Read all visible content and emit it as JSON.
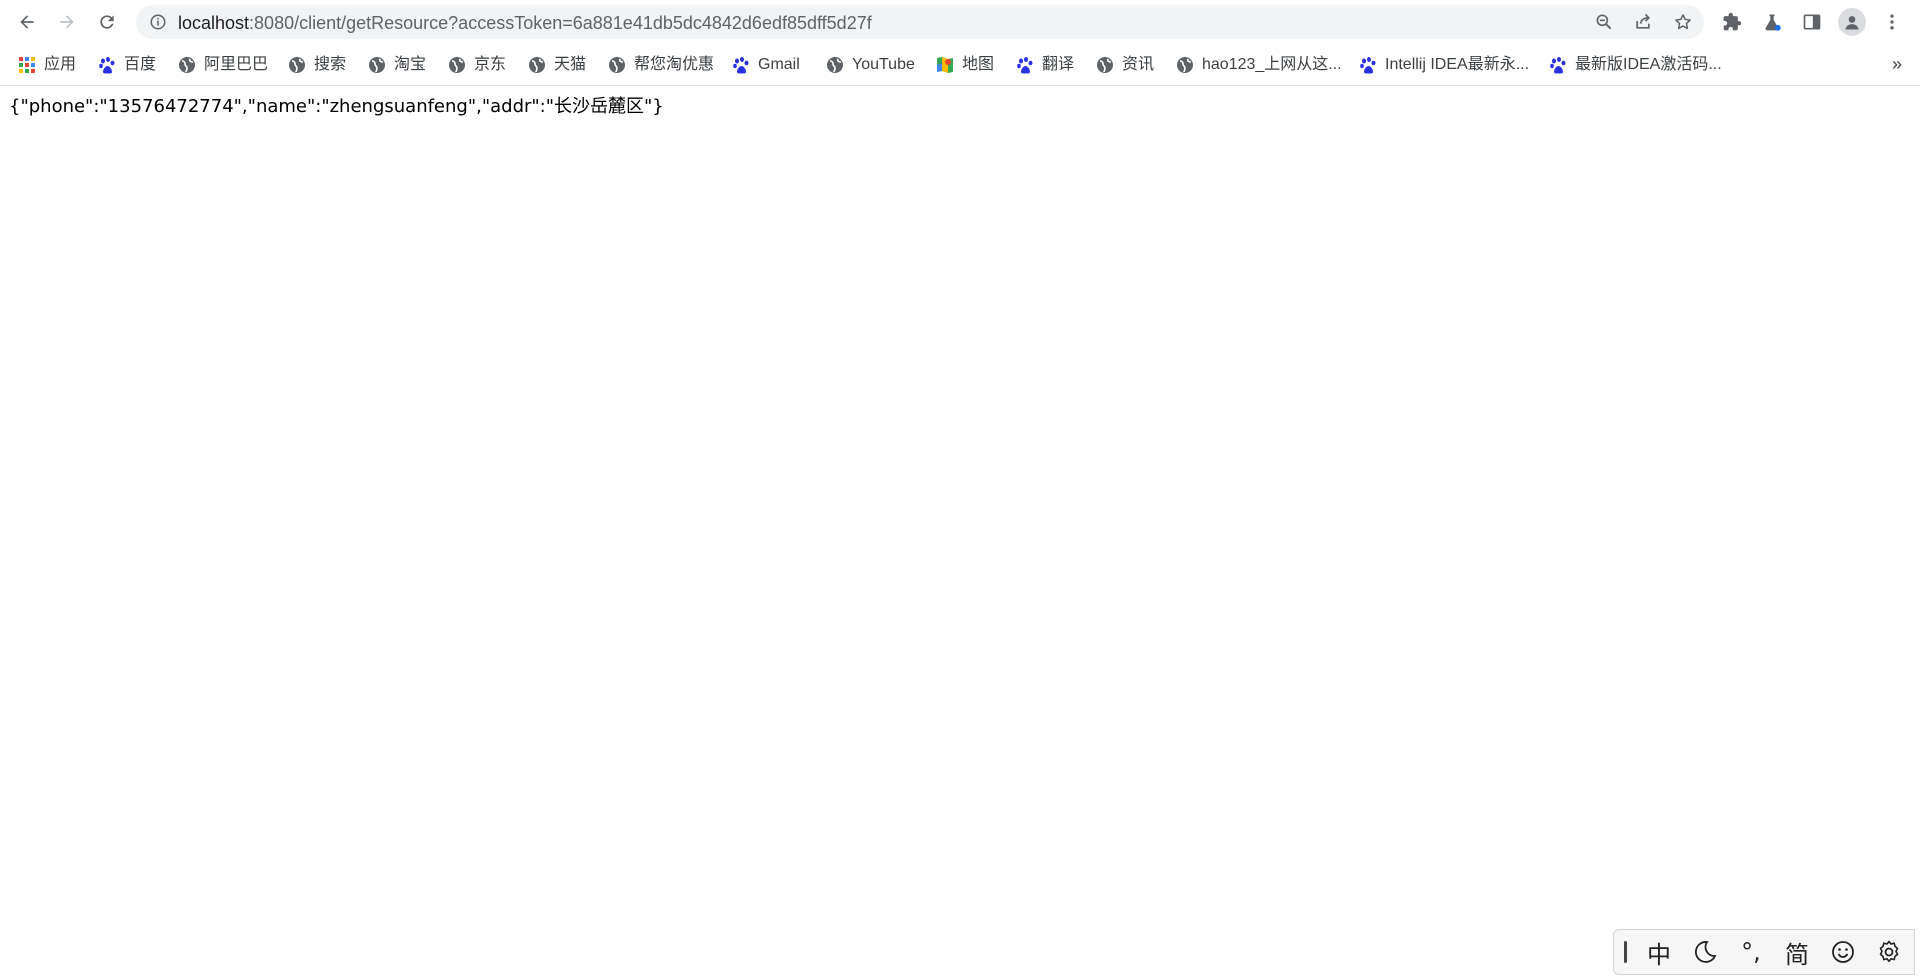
{
  "browser": {
    "url_host": "localhost",
    "url_path": ":8080/client/getResource?accessToken=6a881e41db5dc4842d6edf85dff5d27f"
  },
  "bookmarks": [
    {
      "label": "应用",
      "icon": "apps-grid-icon"
    },
    {
      "label": "百度",
      "icon": "baidu-paw-icon"
    },
    {
      "label": "阿里巴巴",
      "icon": "globe-icon"
    },
    {
      "label": "搜索",
      "icon": "globe-icon"
    },
    {
      "label": "淘宝",
      "icon": "globe-icon"
    },
    {
      "label": "京东",
      "icon": "globe-icon"
    },
    {
      "label": "天猫",
      "icon": "globe-icon"
    },
    {
      "label": "帮您淘优惠",
      "icon": "globe-icon"
    },
    {
      "label": "Gmail",
      "icon": "baidu-paw-icon"
    },
    {
      "label": "YouTube",
      "icon": "globe-icon"
    },
    {
      "label": "地图",
      "icon": "maps-icon"
    },
    {
      "label": "翻译",
      "icon": "baidu-paw-icon"
    },
    {
      "label": "资讯",
      "icon": "globe-icon"
    },
    {
      "label": "hao123_上网从这...",
      "icon": "globe-icon"
    },
    {
      "label": "Intellij IDEA最新永...",
      "icon": "baidu-paw-icon"
    },
    {
      "label": "最新版IDEA激活码...",
      "icon": "baidu-paw-icon"
    }
  ],
  "bookmarks_overflow": "»",
  "content": {
    "json_text": "{\"phone\":\"13576472774\",\"name\":\"zhengsuanfeng\",\"addr\":\"长沙岳麓区\"}"
  },
  "ime": {
    "mode": "中",
    "punct": "°,",
    "charset": "简"
  },
  "colors": {
    "omnibox_bg": "#f1f3f4",
    "baidu_blue": "#2932e1",
    "icon_gray": "#5f6368"
  }
}
